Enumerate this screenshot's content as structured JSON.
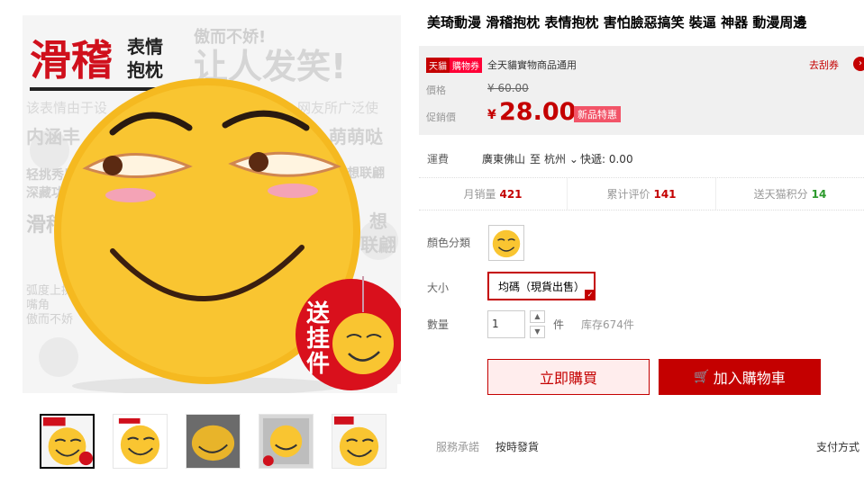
{
  "product": {
    "title": "美琦動漫 滑稽抱枕 表情抱枕 害怕臉惡搞笑 裝逼 神器 動漫周邊"
  },
  "gallery": {
    "main_image": {
      "headline_1": "滑稽",
      "headline_2": "表情",
      "headline_3": "抱枕",
      "slogan_1": "傲而不娇!",
      "slogan_2": "让人发笑!",
      "side_1": "该表情由于设",
      "side_2": "网友所广泛使",
      "side_3": "内涵丰",
      "side_4": "萌萌哒",
      "side_5": "轻挑秀眉",
      "side_6": "深藏功",
      "side_7": "想联翩",
      "side_8": "滑稽",
      "side_9": "想",
      "side_10": "联翩",
      "side_11": "弧度上挑",
      "side_12": "嘴角",
      "side_13": "傲而不娇",
      "badge_1": "送",
      "badge_2": "挂",
      "badge_3": "件"
    },
    "thumb_count": 5
  },
  "price": {
    "tmall_badge": "天貓",
    "coupon_badge": "購物券",
    "coupon_text": "全天貓實物商品通用",
    "coupon_action": "去刮券",
    "original_label": "價格",
    "original_price": "¥ 60.00",
    "promo_label": "促銷價",
    "promo_currency": "¥",
    "promo_price": "28.00",
    "promo_tag": "新品特惠"
  },
  "shipping": {
    "label": "運費",
    "from": "廣東佛山",
    "to": "至",
    "city": "杭州",
    "express": "快遞: 0.00"
  },
  "stats": [
    {
      "label": "月销量",
      "value": "421"
    },
    {
      "label": "累计评价",
      "value": "141"
    },
    {
      "label": "送天猫积分",
      "value": "14"
    }
  ],
  "options": {
    "color_label": "顏色分類",
    "size_label": "大小",
    "size_value": "均碼（現貨出售）",
    "qty_label": "數量",
    "qty_value": "1",
    "qty_unit": "件",
    "stock": "库存674件"
  },
  "actions": {
    "buy_now": "立即購買",
    "add_cart": "加入購物車"
  },
  "service": {
    "label": "服務承諾",
    "item": "按時發貨",
    "payment": "支付方式"
  },
  "colors": {
    "accent": "#c40000",
    "face": "#f7c22d",
    "blush": "#f4a3b6"
  }
}
